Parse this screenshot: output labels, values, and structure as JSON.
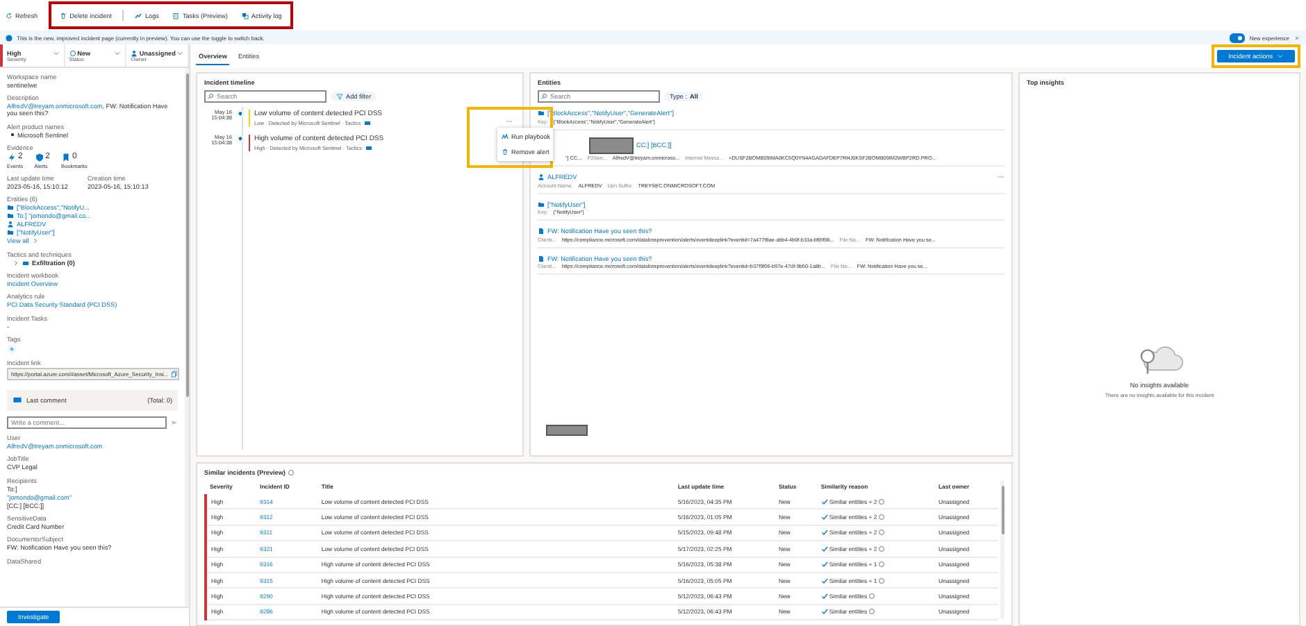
{
  "toolbar": [
    {
      "label": "Refresh",
      "highlighted": false
    },
    {
      "label": "Delete incident",
      "highlighted": true
    },
    {
      "label": "Logs",
      "highlighted": true
    },
    {
      "label": "Tasks (Preview)",
      "highlighted": true
    },
    {
      "label": "Activity log",
      "highlighted": true
    }
  ],
  "infobar": {
    "text": "This is the new, improved incident page (currently in preview). You can use the toggle to switch back.",
    "toggle": {
      "label": "New experience",
      "on": true
    }
  },
  "left_panel": {
    "selectors": [
      {
        "value": "High",
        "label": "Severity",
        "kind": "severity"
      },
      {
        "value": "New",
        "label": "Status",
        "kind": "status"
      },
      {
        "value": "Unassigned",
        "label": "Owner",
        "kind": "owner"
      }
    ],
    "workspace": {
      "label": "Workspace name",
      "value": "sentinelwe"
    },
    "description": {
      "label": "Description",
      "link": "AlfredV@treyam.onmicrosoft.com,",
      "text": "FW: Notification Have you seen this?"
    },
    "alert_products": {
      "label": "Alert product names",
      "items": [
        "Microsoft Sentinel"
      ]
    },
    "evidence": {
      "label": "Evidence",
      "items": [
        {
          "kind": "events",
          "count": "2",
          "label": "Events"
        },
        {
          "kind": "alerts",
          "count": "2",
          "label": "Alerts"
        },
        {
          "kind": "bookmarks",
          "count": "0",
          "label": "Bookmarks"
        }
      ]
    },
    "times": [
      {
        "label": "Last update time",
        "value": "2023-05-16, 15:10:12"
      },
      {
        "label": "Creation time",
        "value": "2023-05-16, 15:10:13"
      }
    ],
    "entities": {
      "label": "Entities (6)",
      "items": [
        {
          "kind": "folder",
          "text": "[\"BlockAccess\",\"NotifyU..."
        },
        {
          "kind": "folder",
          "text": "To:] \"jomondo@gmail.co..."
        },
        {
          "kind": "account",
          "text": "ALFREDV"
        },
        {
          "kind": "folder",
          "text": "[\"NotifyUser\"]"
        }
      ],
      "view_all": "View all"
    },
    "tactics": {
      "label": "Tactics and techniques",
      "items": [
        {
          "name": "Exfiltration (0)",
          "expanded": false
        }
      ]
    },
    "links": [
      {
        "label": "Incident workbook",
        "value": "Incident Overview"
      },
      {
        "label": "Analytics rule",
        "value": "PCI Data Security Standard (PCI DSS)"
      }
    ],
    "tasks": {
      "label": "Incident Tasks",
      "value": "-"
    },
    "tags": {
      "label": "Tags"
    },
    "incident_link": {
      "label": "Incident link",
      "value": "https://portal.azure.com/#asset/Microsoft_Azure_Security_Insi..."
    },
    "comment": {
      "title": "Last comment",
      "total": "(Total: 0)",
      "placeholder": "Write a comment..."
    },
    "details": [
      {
        "label": "User",
        "lines": [
          {
            "text": "AlfredV@treyam.onmicrosoft.com",
            "link": true
          }
        ]
      },
      {
        "label": "JobTitle",
        "lines": [
          {
            "text": "CVP Legal",
            "link": false
          }
        ]
      },
      {
        "label": "Recipients",
        "lines": [
          {
            "text": "To:]",
            "link": false
          },
          {
            "text": "\"jomondo@gmail.com\"",
            "link": true
          },
          {
            "text": "[CC:] [BCC:]]",
            "link": false
          }
        ]
      },
      {
        "label": "SensitiveData",
        "lines": [
          {
            "text": "Credit Card Number",
            "link": false
          }
        ]
      },
      {
        "label": "DocumentorSubject",
        "lines": [
          {
            "text": "FW: Notification Have you seen this?",
            "link": false
          }
        ]
      },
      {
        "label": "DataShared"
      }
    ],
    "investigate": "Investigate"
  },
  "tabs": [
    {
      "label": "Overview",
      "selected": true
    },
    {
      "label": "Entities",
      "selected": false
    }
  ],
  "incident_actions": {
    "label": "Incident actions",
    "highlighted": true
  },
  "timeline": {
    "title": "Incident timeline",
    "search_placeholder": "Search",
    "filter": "Add filter",
    "items": [
      {
        "date": "May 16",
        "time": "15:04:38",
        "title": "Low volume of content detected PCI DSS",
        "kind": "low",
        "meta": "Low · Detected by Microsoft Sentinel · Tactics"
      },
      {
        "date": "May 16",
        "time": "15:04:38",
        "title": "High volume of content detected PCI DSS",
        "kind": "high",
        "meta": "High · Detected by Microsoft Sentinel · Tactics"
      }
    ]
  },
  "context_menu": {
    "highlighted": true,
    "items": [
      {
        "label": "Run playbook"
      },
      {
        "label": "Remove alert"
      }
    ]
  },
  "entities": {
    "title": "Entities",
    "search_placeholder": "Search",
    "type_filter": {
      "label": "Type :",
      "value": "All"
    },
    "footer_redacted": true,
    "items": [
      {
        "kind": "folder",
        "title": "[\"BlockAccess\",\"NotifyUser\",\"GenerateAlert\"]",
        "redacted": false,
        "more": false,
        "details": [
          {
            "kind": "label",
            "text": "Key:"
          },
          {
            "kind": "value",
            "text": "[\"BlockAccess\",\"NotifyUser\",\"GenerateAlert\"]"
          }
        ]
      },
      {
        "kind": "folder",
        "title": "CC:] [BCC:]]",
        "redacted": true,
        "more": false,
        "details": [
          {
            "kind": "value",
            "text": "\"] CC..."
          },
          {
            "kind": "label",
            "text": "P2Sen..."
          },
          {
            "kind": "value",
            "text": "AlfredV@treyam.onmicroso..."
          },
          {
            "kind": "label",
            "text": "Internet Messa..."
          },
          {
            "kind": "value",
            "text": "<DUSF2BOMB09IMA0KC5Q0YN4AGADAFDEP7RHJ0KSF2BOMB09IM2WBP2RD.PRO..."
          }
        ]
      },
      {
        "kind": "account",
        "title": "ALFREDV",
        "redacted": false,
        "more": true,
        "details": [
          {
            "kind": "label",
            "text": "Account Name:"
          },
          {
            "kind": "value",
            "text": "ALFREDV"
          },
          {
            "kind": "label",
            "text": "Upn Suffix:"
          },
          {
            "kind": "value",
            "text": "TREYSEC.ONMICROSOFT.COM"
          }
        ]
      },
      {
        "kind": "folder",
        "title": "[\"NotifyUser\"]",
        "redacted": false,
        "more": false,
        "details": [
          {
            "kind": "label",
            "text": "Key:"
          },
          {
            "kind": "value",
            "text": "[\"NotifyUser\"]"
          }
        ]
      },
      {
        "kind": "file",
        "title": "FW: Notification Have you seen this?",
        "redacted": false,
        "more": false,
        "details": [
          {
            "kind": "label",
            "text": "Clienti..."
          },
          {
            "kind": "value",
            "text": "https://compliance.microsoft.com/datalossprevention/alerts/eventdeeplink?eventid=7a477f8ae-abb4-4b0f-b33a-bf8998..."
          },
          {
            "kind": "label",
            "text": "File Na..."
          },
          {
            "kind": "value",
            "text": "FW: Notification Have you se..."
          }
        ]
      },
      {
        "kind": "file",
        "title": "FW: Notification Have you seen this?",
        "redacted": false,
        "more": false,
        "details": [
          {
            "kind": "label",
            "text": "Clienti..."
          },
          {
            "kind": "value",
            "text": "https://compliance.microsoft.com/datalossprevention/alerts/eventdeeplink?eventid=b37f9f06-b97e-47df-9b50-1a8b..."
          },
          {
            "kind": "label",
            "text": "File Na..."
          },
          {
            "kind": "value",
            "text": "FW: Notification Have you se..."
          }
        ]
      }
    ]
  },
  "similar": {
    "title": "Similar incidents (Preview)",
    "columns": [
      "Severity",
      "Incident ID",
      "Title",
      "Last update time",
      "Status",
      "Similarity reason",
      "Last owner"
    ],
    "rows": [
      {
        "kind": "high",
        "severity": "High",
        "id": "9314",
        "title": "Low volume of content detected PCI DSS",
        "updated": "5/16/2023, 04:35 PM",
        "status": "New",
        "reason": "Similar entities + 2",
        "owner": "Unassigned"
      },
      {
        "kind": "high",
        "severity": "High",
        "id": "9312",
        "title": "Low volume of content detected PCI DSS",
        "updated": "5/16/2023, 01:05 PM",
        "status": "New",
        "reason": "Similar entities + 2",
        "owner": "Unassigned"
      },
      {
        "kind": "high",
        "severity": "High",
        "id": "9311",
        "title": "Low volume of content detected PCI DSS",
        "updated": "5/15/2023, 09:48 PM",
        "status": "New",
        "reason": "Similar entities + 2",
        "owner": "Unassigned"
      },
      {
        "kind": "high",
        "severity": "High",
        "id": "9321",
        "title": "Low volume of content detected PCI DSS",
        "updated": "5/17/2023, 02:25 PM",
        "status": "New",
        "reason": "Similar entities + 2",
        "owner": "Unassigned"
      },
      {
        "kind": "high",
        "severity": "High",
        "id": "9316",
        "title": "High volume of content detected PCI DSS",
        "updated": "5/16/2023, 05:38 PM",
        "status": "New",
        "reason": "Similar entities + 1",
        "owner": "Unassigned"
      },
      {
        "kind": "high",
        "severity": "High",
        "id": "9315",
        "title": "High volume of content detected PCI DSS",
        "updated": "5/16/2023, 05:05 PM",
        "status": "New",
        "reason": "Similar entities + 1",
        "owner": "Unassigned"
      },
      {
        "kind": "high",
        "severity": "High",
        "id": "9290",
        "title": "High volume of content detected PCI DSS",
        "updated": "5/12/2023, 06:43 PM",
        "status": "New",
        "reason": "Similar entities",
        "owner": "Unassigned"
      },
      {
        "kind": "high",
        "severity": "High",
        "id": "9286",
        "title": "High volume of content detected PCI DSS",
        "updated": "5/12/2023, 06:43 PM",
        "status": "New",
        "reason": "Similar entities",
        "owner": "Unassigned"
      }
    ]
  },
  "insights": {
    "title": "Top insights",
    "empty_title": "No insights available",
    "empty_text": "There are no insights available for this incident"
  }
}
